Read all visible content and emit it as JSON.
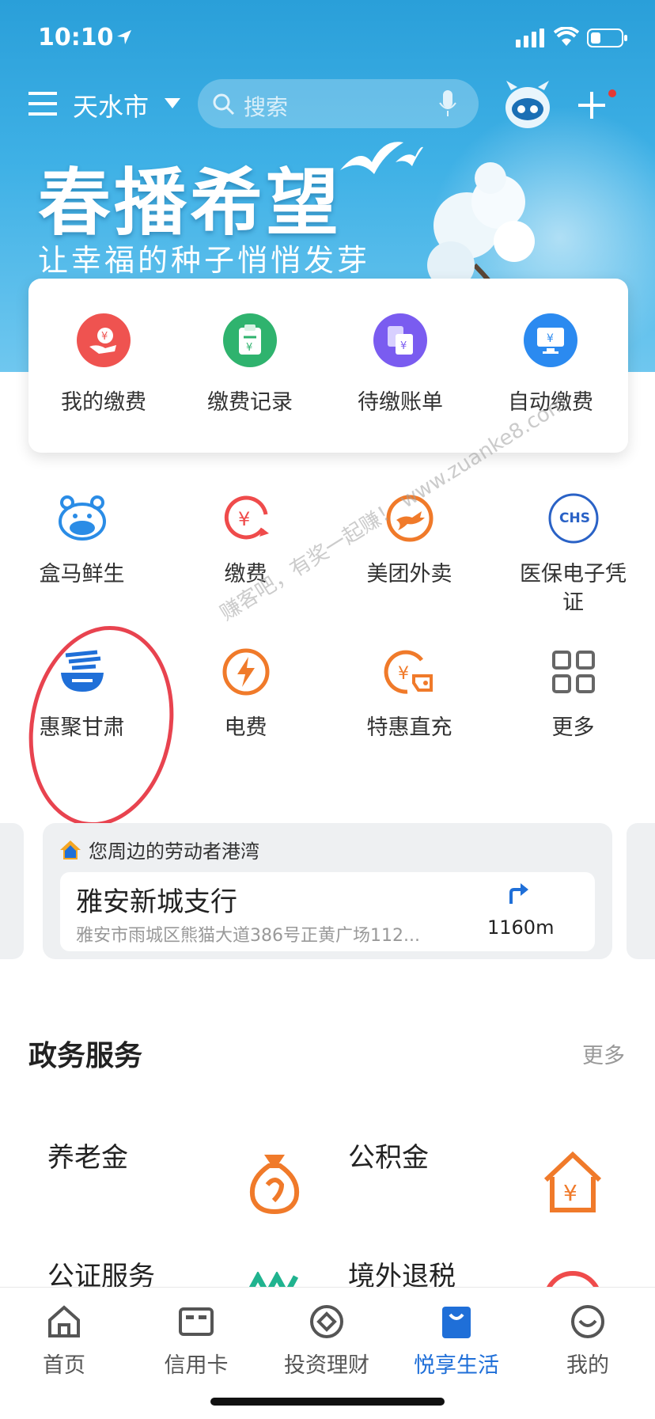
{
  "status_bar": {
    "time": "10:10"
  },
  "header": {
    "city": "天水市",
    "search_placeholder": "搜索"
  },
  "banner": {
    "title": "春播希望",
    "subtitle": "让幸福的种子悄悄发芽"
  },
  "pay_card": {
    "items": [
      {
        "label": "我的缴费",
        "icon": "hand-yuan-icon",
        "color": "#ef5350"
      },
      {
        "label": "缴费记录",
        "icon": "clipboard-yuan-icon",
        "color": "#2fb36e"
      },
      {
        "label": "待缴账单",
        "icon": "bills-icon",
        "color": "#7a5cf0"
      },
      {
        "label": "自动缴费",
        "icon": "monitor-yuan-icon",
        "color": "#2b8af0"
      }
    ]
  },
  "services_grid": {
    "items": [
      {
        "label": "盒马鲜生",
        "icon": "hippo-icon"
      },
      {
        "label": "缴费",
        "icon": "yuan-refresh-icon"
      },
      {
        "label": "美团外卖",
        "icon": "kangaroo-icon"
      },
      {
        "label": "医保电子凭证",
        "icon": "chs-badge-icon",
        "badge_text": "CHS"
      },
      {
        "label": "惠聚甘肃",
        "icon": "bowl-icon"
      },
      {
        "label": "电费",
        "icon": "lightning-icon"
      },
      {
        "label": "特惠直充",
        "icon": "coin-tag-icon"
      },
      {
        "label": "更多",
        "icon": "grid-icon"
      }
    ]
  },
  "watermark": "赚客吧，有奖一起赚！ www.zuanke8.com",
  "nearby": {
    "header": "您周边的劳动者港湾",
    "name": "雅安新城支行",
    "address": "雅安市雨城区熊猫大道386号正黄广场112...",
    "distance": "1160m"
  },
  "gov_services": {
    "title": "政务服务",
    "more": "更多",
    "items": [
      {
        "label": "养老金",
        "icon": "money-bag-icon"
      },
      {
        "label": "公积金",
        "icon": "house-yuan-icon"
      },
      {
        "label": "公证服务",
        "icon": "notary-icon"
      },
      {
        "label": "境外退税",
        "icon": "tax-refund-icon"
      }
    ]
  },
  "tabbar": {
    "tabs": [
      {
        "label": "首页",
        "icon": "home-icon"
      },
      {
        "label": "信用卡",
        "icon": "credit-card-icon"
      },
      {
        "label": "投资理财",
        "icon": "invest-icon"
      },
      {
        "label": "悦享生活",
        "icon": "shopping-bag-icon",
        "active": true
      },
      {
        "label": "我的",
        "icon": "profile-icon"
      }
    ]
  }
}
